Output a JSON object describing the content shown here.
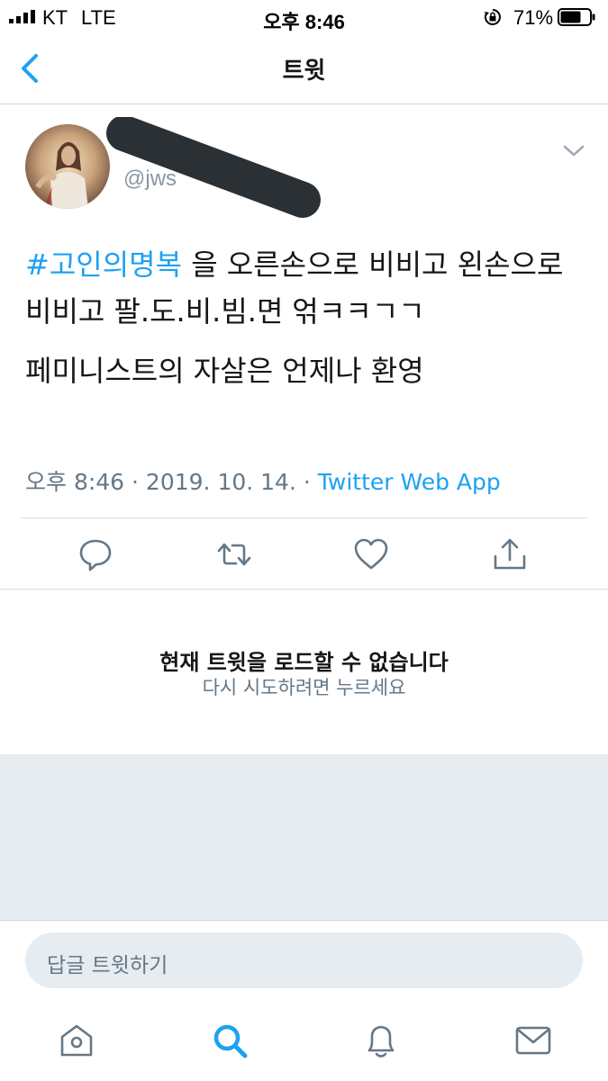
{
  "status_bar": {
    "carrier": "KT",
    "network": "LTE",
    "time": "오후 8:46",
    "battery_percent": "71%",
    "battery_level": 0.71
  },
  "nav": {
    "title": "트윗",
    "back_icon": "chevron-left-icon"
  },
  "tweet": {
    "handle": "@jws",
    "hashtag": "#고인의명복",
    "line1_rest": " 을 오른손으로 비비고 왼손으로 비비고 팔.도.비.빔.면 얶ㅋㅋㄱㄱ",
    "line2": "페미니스트의 자살은 언제나 환영",
    "timestamp": "오후 8:46 · 2019. 10. 14. · ",
    "source": "Twitter Web App"
  },
  "actions": [
    "reply-icon",
    "retweet-icon",
    "like-icon",
    "share-icon"
  ],
  "error": {
    "title": "현재 트윗을 로드할 수 없습니다",
    "retry": "다시 시도하려면 누르세요"
  },
  "reply_box": {
    "placeholder": "답글 트윗하기"
  },
  "tab_bar": [
    "home-icon",
    "search-icon",
    "notifications-icon",
    "messages-icon"
  ],
  "colors": {
    "accent": "#1da1f2",
    "text": "#14171a",
    "secondary": "#657786",
    "background_grey": "#e6ecf0"
  }
}
